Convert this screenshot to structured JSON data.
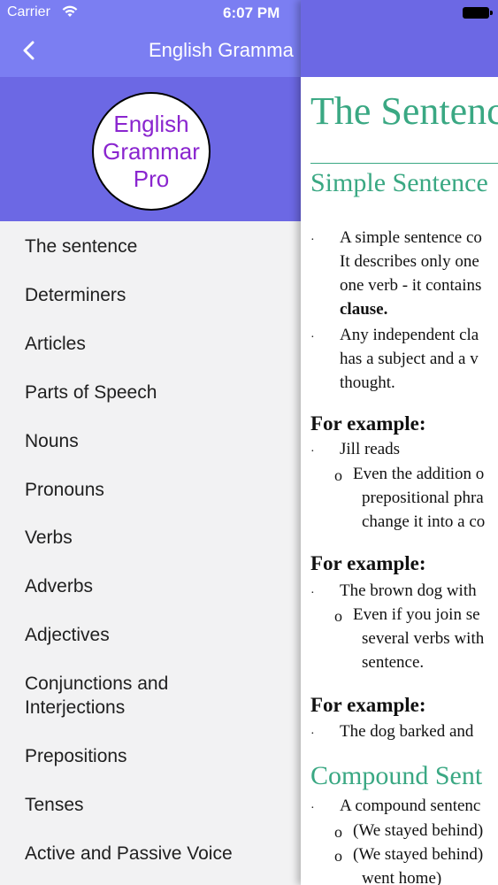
{
  "status_bar": {
    "carrier": "Carrier",
    "time": "6:07 PM"
  },
  "drawer": {
    "title": "English Gramma",
    "back_icon": "chevron-left-icon",
    "logo": {
      "line1": "English",
      "line2": "Grammar",
      "line3": "Pro"
    },
    "items": [
      {
        "label": "The sentence"
      },
      {
        "label": "Determiners"
      },
      {
        "label": "Articles"
      },
      {
        "label": "Parts of Speech"
      },
      {
        "label": "Nouns"
      },
      {
        "label": "Pronouns"
      },
      {
        "label": "Verbs"
      },
      {
        "label": "Adverbs"
      },
      {
        "label": "Adjectives"
      },
      {
        "label": "Conjunctions and Interjections"
      },
      {
        "label": "Prepositions"
      },
      {
        "label": "Tenses"
      },
      {
        "label": "Active and Passive Voice"
      }
    ]
  },
  "content": {
    "title": "The Sentenc",
    "section1": {
      "heading": "Simple Sentence",
      "p1_l1": "A simple sentence co",
      "p1_l2": "It describes only one",
      "p1_l3": "one verb - it contains",
      "p1_l4": "clause.",
      "p2_l1": "Any independent cla",
      "p2_l2": "has a subject and a v",
      "p2_l3": "thought.",
      "ex1_heading": "For example:",
      "ex1_item": "Jill reads",
      "ex1_sub_l1": "Even the addition o",
      "ex1_sub_l2": "prepositional phra",
      "ex1_sub_l3": "change it into a co",
      "ex2_heading": "For example:",
      "ex2_item": "The brown dog with",
      "ex2_sub_l1": "Even if you join se",
      "ex2_sub_l2": "several verbs with",
      "ex2_sub_l3": "sentence.",
      "ex3_heading": "For example:",
      "ex3_item": "The dog barked and"
    },
    "section2": {
      "heading": "Compound Sent",
      "p1": "A compound sentenc",
      "sub1": "(We stayed behind)",
      "sub2_l1": "(We stayed behind)",
      "sub2_l2": "went home)"
    }
  },
  "colors": {
    "nav_purple": "#7b7ef2",
    "header_purple": "#6c68e4",
    "logo_text": "#8a25cf",
    "heading_green": "#3aa883"
  }
}
